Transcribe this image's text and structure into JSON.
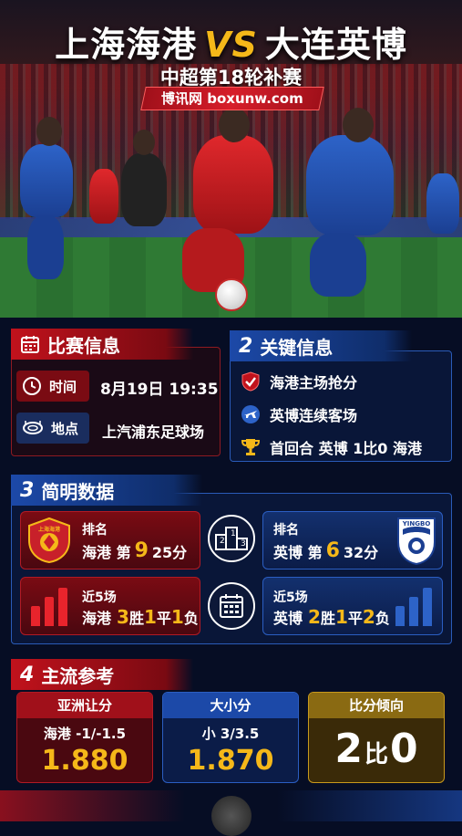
{
  "header": {
    "home_team": "上海海港",
    "vs": "VS",
    "away_team": "大连英博",
    "subtitle": "中超第18轮补赛",
    "brand": "博讯网 boxunw.com"
  },
  "match_info": {
    "title": "比赛信息",
    "time_label": "时间",
    "time_value": "8月19日 19:35",
    "venue_label": "地点",
    "venue_value": "上汽浦东足球场"
  },
  "key_info": {
    "num": "2",
    "title": "关键信息",
    "items": [
      "海港主场抢分",
      "英博连续客场",
      "首回合 英博 1比0 海港"
    ]
  },
  "stats": {
    "num": "3",
    "title": "简明数据",
    "home_rank_label": "排名",
    "home_rank_team": "海港 第",
    "home_rank": "9",
    "home_points": "25分",
    "away_rank_label": "排名",
    "away_rank_team": "英博 第",
    "away_rank": "6",
    "away_points": "32分",
    "home_form_label": "近5场",
    "home_form_team": "海港",
    "home_w": "3",
    "w_unit": "胜",
    "home_d": "1",
    "d_unit": "平",
    "home_l": "1",
    "l_unit": "负",
    "away_form_label": "近5场",
    "away_form_team": "英博",
    "away_w": "2",
    "away_d": "1",
    "away_l": "2",
    "home_badge_text": "上海海港",
    "away_badge_text": "YINGBO",
    "podium": [
      "2",
      "1",
      "3"
    ]
  },
  "reference": {
    "num": "4",
    "title": "主流参考",
    "asian_title": "亚洲让分",
    "asian_line": "海港 -1/-1.5",
    "asian_odds": "1.880",
    "ou_title": "大小分",
    "ou_line": "小 3/3.5",
    "ou_odds": "1.870",
    "score_title": "比分倾向",
    "score_home": "2",
    "score_mid": "比",
    "score_away": "0"
  },
  "colors": {
    "accent_red": "#c1121c",
    "accent_blue": "#1c49a8",
    "gold": "#f5b819"
  }
}
